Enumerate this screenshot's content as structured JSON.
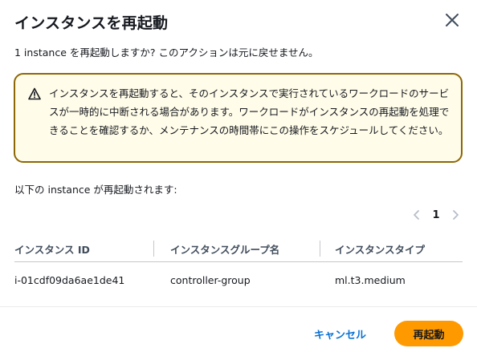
{
  "dialog": {
    "title": "インスタンスを再起動",
    "description": "1 instance を再起動しますか? このアクションは元に戻せません。"
  },
  "warning": {
    "text": "インスタンスを再起動すると、そのインスタンスで実行されているワークロードのサービスが一時的に中断される場合があります。ワークロードがインスタンスの再起動を処理できることを確認するか、メンテナンスの時間帯にこの操作をスケジュールしてください。",
    "icon": "warning-triangle-icon",
    "border_color": "#8d6605",
    "background_color": "#fffce9"
  },
  "list_label": "以下の instance が再起動されます:",
  "pagination": {
    "current_page": "1"
  },
  "table": {
    "columns": [
      "インスタンス ID",
      "インスタンスグループ名",
      "インスタンスタイプ"
    ],
    "rows": [
      [
        "i-01cdf09da6ae1de41",
        "controller-group",
        "ml.t3.medium"
      ]
    ]
  },
  "footer": {
    "cancel_label": "キャンセル",
    "confirm_label": "再起動",
    "confirm_color": "#ff9900",
    "link_color": "#0972d3"
  }
}
